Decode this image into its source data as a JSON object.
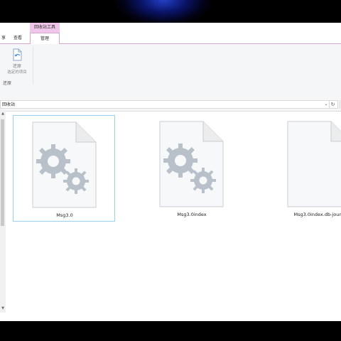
{
  "ribbon": {
    "context_title": "回收站工具",
    "tabs": [
      {
        "label": "享"
      },
      {
        "label": "查看"
      },
      {
        "label": "管理"
      }
    ],
    "restore_button": {
      "label": "还原",
      "sublabel": "选定的项目",
      "icon": "restore-icon"
    },
    "group_label": "还原"
  },
  "address_bar": {
    "path": "回收站",
    "dropdown_icon": "chevron-down-icon",
    "refresh_icon": "refresh-icon"
  },
  "files": [
    {
      "name": "Msg3.0",
      "icon": "system-file-gear-icon",
      "selected": true
    },
    {
      "name": "Msg3.0index",
      "icon": "system-file-gear-icon",
      "selected": false
    },
    {
      "name": "Msg3.0index.db-jour",
      "icon": "blank-file-icon",
      "selected": false
    }
  ],
  "colors": {
    "context_tab": "#f0c6ea",
    "selection_border": "#99d1f6",
    "ribbon_bg": "#f5f6f7"
  }
}
